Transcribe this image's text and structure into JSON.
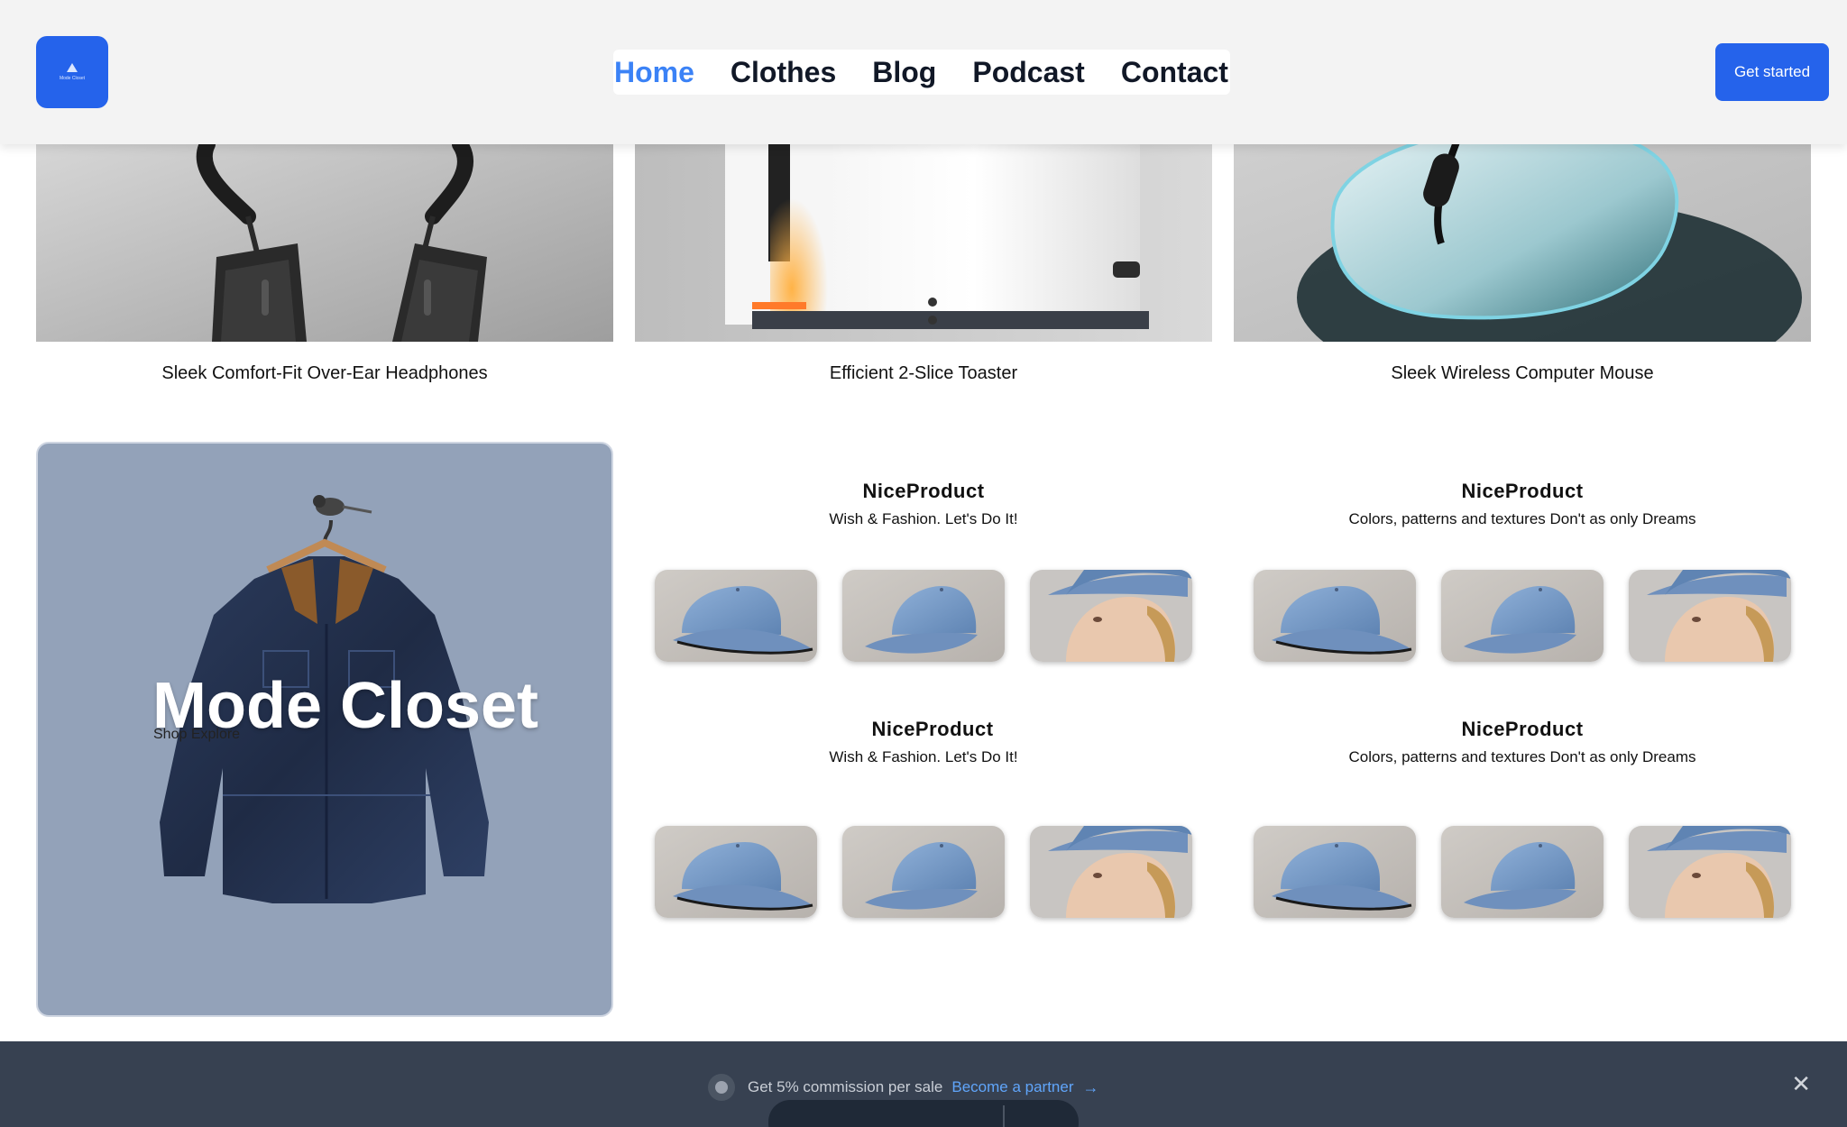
{
  "header": {
    "logo_text": "Mode Closet",
    "nav": [
      "Home",
      "Clothes",
      "Blog",
      "Podcast",
      "Contact"
    ],
    "cta_label": "Get started"
  },
  "products": [
    {
      "caption": "Sleek Comfort-Fit Over-Ear Headphones",
      "image": "headphones-image"
    },
    {
      "caption": "Efficient 2-Slice Toaster",
      "image": "toaster-image"
    },
    {
      "caption": "Sleek Wireless Computer Mouse",
      "image": "mouse-image"
    }
  ],
  "hero": {
    "title": "Mode Closet",
    "subtitle": "Shop Explore"
  },
  "groups": [
    {
      "title": "NiceProduct",
      "subtitle": "Wish & Fashion. Let's Do It!"
    },
    {
      "title": "NiceProduct",
      "subtitle": "Colors, patterns and textures Don't as only Dreams"
    },
    {
      "title": "NiceProduct",
      "subtitle": "Wish & Fashion. Let's Do It!"
    },
    {
      "title": "NiceProduct",
      "subtitle": "Colors, patterns and textures Don't as only Dreams"
    }
  ],
  "bottom_bar": {
    "promo_text": "Get 5% commission per sale",
    "promo_link": "Become a partner",
    "arrow": "→",
    "close": "✕"
  },
  "colors": {
    "brand": "#2563eb",
    "nav_active": "#3b82f6",
    "hero_bg": "#93a2b9",
    "bottom_bg": "#374151"
  }
}
